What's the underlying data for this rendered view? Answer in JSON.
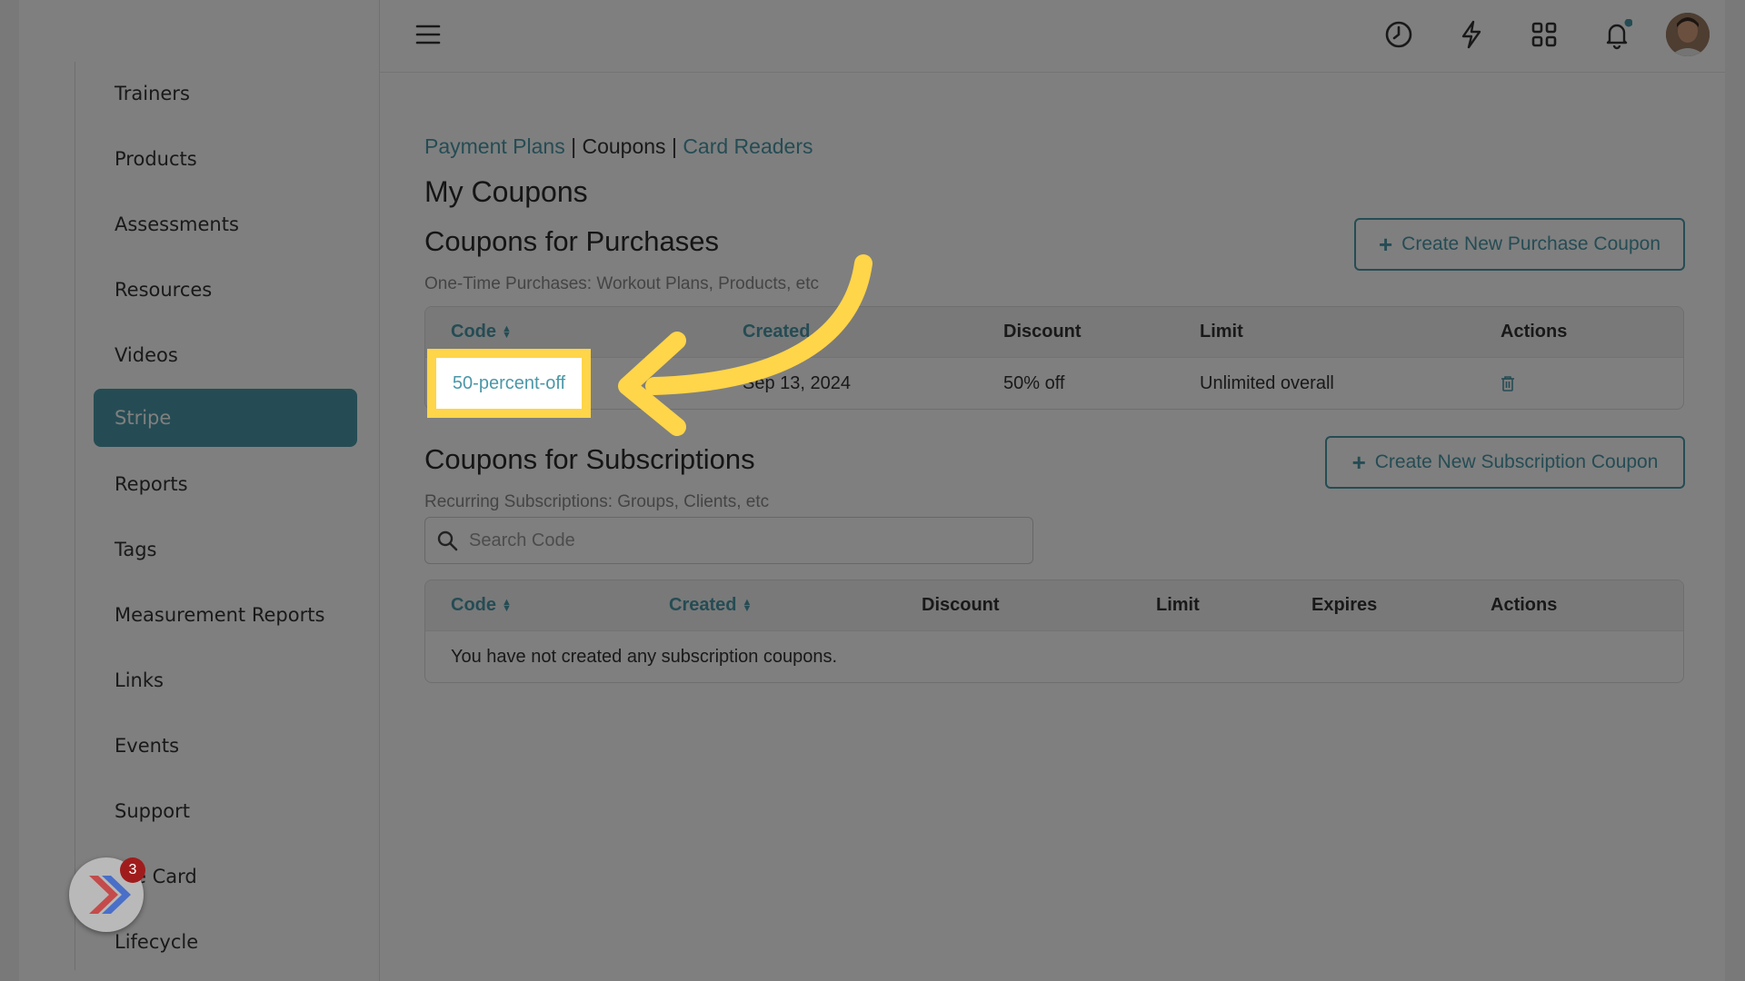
{
  "sidebar": {
    "items": [
      {
        "label": "Trainers",
        "active": false
      },
      {
        "label": "Products",
        "active": false
      },
      {
        "label": "Assessments",
        "active": false
      },
      {
        "label": "Resources",
        "active": false
      },
      {
        "label": "Videos",
        "active": false
      },
      {
        "label": "Stripe",
        "active": true
      },
      {
        "label": "Reports",
        "active": false
      },
      {
        "label": "Tags",
        "active": false
      },
      {
        "label": "Measurement Reports",
        "active": false
      },
      {
        "label": "Links",
        "active": false
      },
      {
        "label": "Events",
        "active": false
      },
      {
        "label": "Support",
        "active": false
      },
      {
        "label": "e Card",
        "active": false
      },
      {
        "label": "Lifecycle",
        "active": false
      }
    ]
  },
  "topbar": {
    "icons": [
      "menu-icon",
      "clock-icon",
      "lightning-icon",
      "apps-grid-icon",
      "bell-icon",
      "avatar"
    ],
    "notification_dot_color": "#4b98a8"
  },
  "breadcrumb": {
    "payment_plans": "Payment Plans",
    "sep1": "|",
    "coupons": "Coupons",
    "sep2": "|",
    "card_readers": "Card Readers"
  },
  "page": {
    "title": "My Coupons",
    "purchases": {
      "heading": "Coupons for Purchases",
      "subtitle": "One-Time Purchases: Workout Plans, Products, etc",
      "create_button": "Create New Purchase Coupon",
      "columns": {
        "code": "Code",
        "created": "Created",
        "discount": "Discount",
        "limit": "Limit",
        "actions": "Actions"
      },
      "rows": [
        {
          "code": "50-percent-off",
          "created": "Sep 13, 2024",
          "discount": "50% off",
          "limit": "Unlimited overall"
        }
      ]
    },
    "subscriptions": {
      "heading": "Coupons for Subscriptions",
      "subtitle": "Recurring Subscriptions: Groups, Clients, etc",
      "create_button": "Create New Subscription Coupon",
      "search_placeholder": "Search Code",
      "columns": {
        "code": "Code",
        "created": "Created",
        "discount": "Discount",
        "limit": "Limit",
        "expires": "Expires",
        "actions": "Actions"
      },
      "empty_message": "You have not created any subscription coupons."
    }
  },
  "widget": {
    "badge_count": "3"
  },
  "colors": {
    "accent": "#4b98a8",
    "highlight": "#ffd54a",
    "overlay": "rgba(0,0,0,0.5)"
  }
}
